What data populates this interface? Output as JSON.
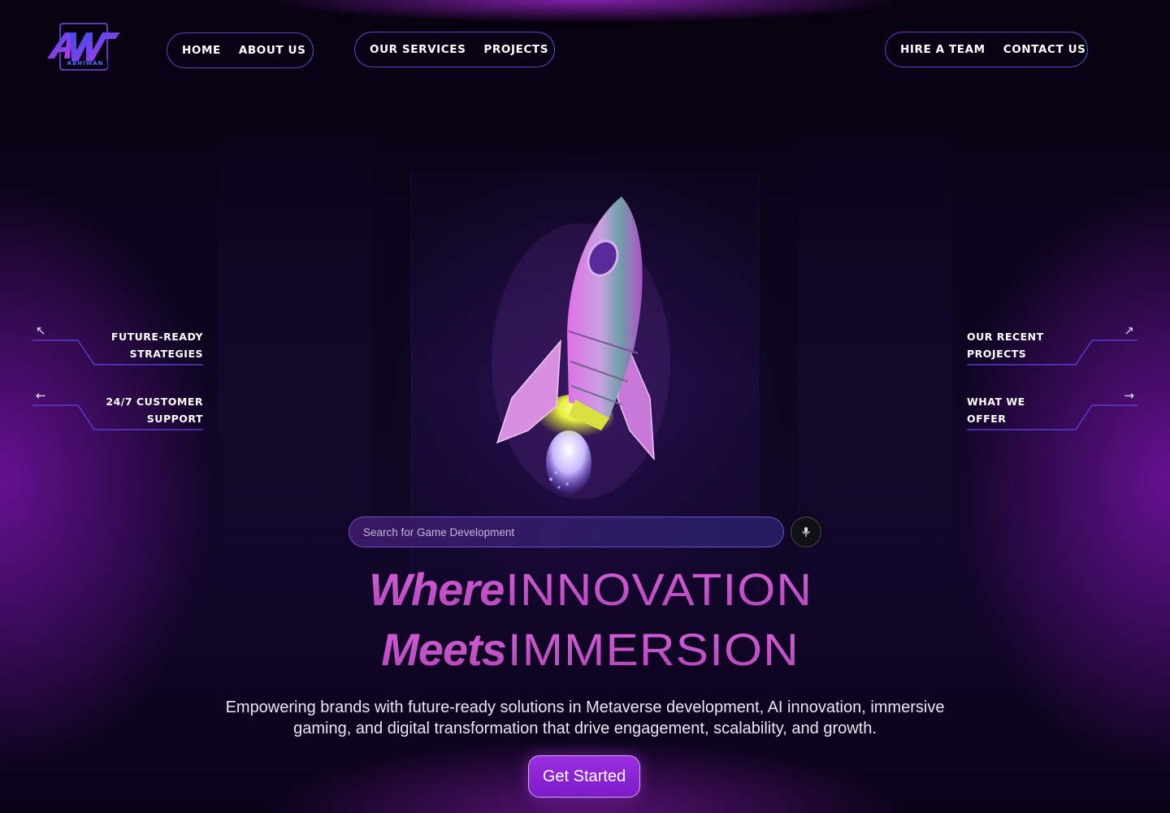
{
  "brand": {
    "logo_monogram": "AW",
    "logo_text": "ABHIWAN"
  },
  "nav": {
    "group1": [
      "HOME",
      "ABOUT US"
    ],
    "group2": [
      "OUR SERVICES",
      "PROJECTS"
    ],
    "group3": [
      "HIRE A TEAM",
      "CONTACT US"
    ]
  },
  "side_left": [
    {
      "line1": "FUTURE-READY",
      "line2": "STRATEGIES",
      "arrow": "↖",
      "icon": "arrow-up-left-icon"
    },
    {
      "line1": "24/7 CUSTOMER",
      "line2": "SUPPORT",
      "arrow": "←",
      "icon": "arrow-left-icon"
    }
  ],
  "side_right": [
    {
      "line1": "OUR RECENT",
      "line2": "PROJECTS",
      "arrow": "↗",
      "icon": "arrow-up-right-icon"
    },
    {
      "line1": "WHAT WE",
      "line2": "OFFER",
      "arrow": "→",
      "icon": "arrow-right-icon"
    }
  ],
  "search": {
    "placeholder": "Search for Game Development",
    "value": ""
  },
  "hero": {
    "line1_script": "Where",
    "line1_wide": "INNOVATION",
    "line2_script": "Meets",
    "line2_wide": "IMMERSION",
    "subtitle": "Empowering brands with future-ready solutions in Metaverse development, AI innovation, immersive gaming, and digital transformation that drive engagement, scalability, and growth.",
    "cta_label": "Get Started"
  },
  "colors": {
    "accent": "#9b2ee0",
    "headline": "#c151c6",
    "nav_border": "#6e46dc",
    "background": "#06020f"
  }
}
